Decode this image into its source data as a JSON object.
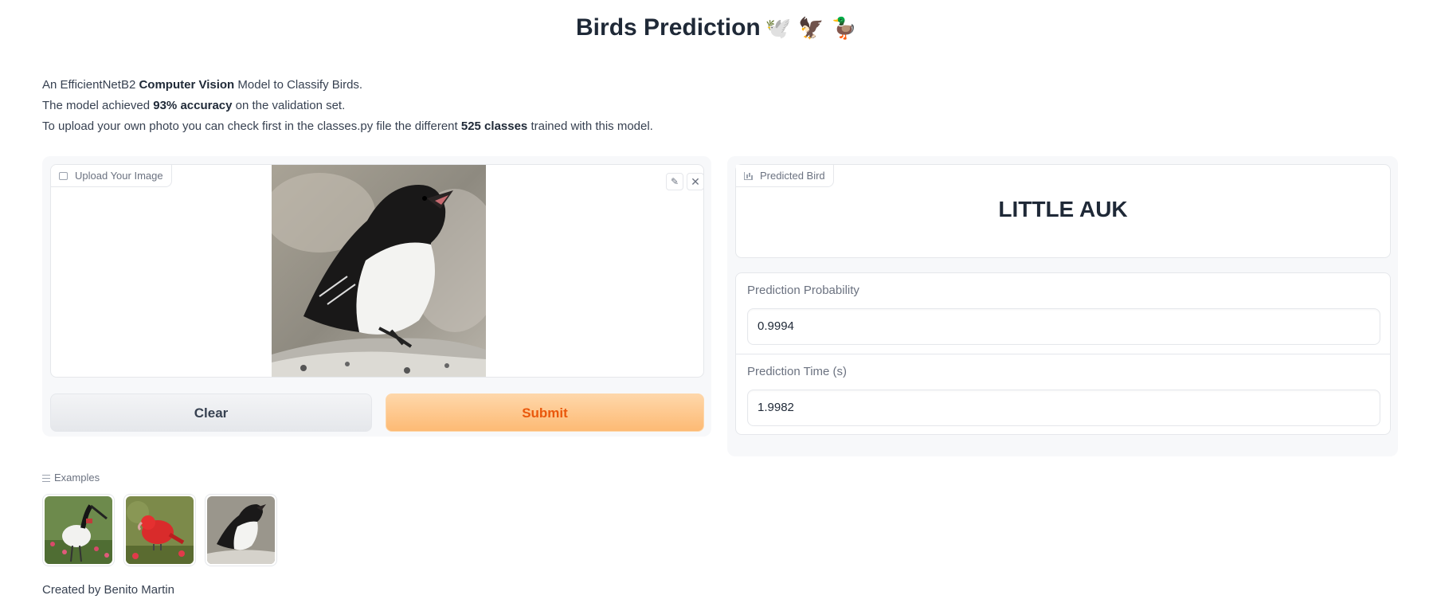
{
  "header": {
    "title": "Birds Prediction",
    "emoji": "🕊️ 🦅 🦆"
  },
  "description": {
    "line1": {
      "pre": "An EfficientNetB2 ",
      "bold": "Computer Vision",
      "post": " Model to Classify Birds."
    },
    "line2": {
      "pre": "The model achieved ",
      "bold": "93% accuracy",
      "post": " on the validation set."
    },
    "line3": {
      "pre": "To upload your own photo you can check first in the classes.py file the different ",
      "bold": "525 classes",
      "post": " trained with this model."
    }
  },
  "upload": {
    "label": "Upload Your Image",
    "edit_icon": "pencil-icon",
    "close_icon": "close-icon"
  },
  "buttons": {
    "clear": "Clear",
    "submit": "Submit"
  },
  "prediction": {
    "label": "Predicted Bird",
    "value": "LITTLE AUK"
  },
  "probability": {
    "label": "Prediction Probability",
    "value": "0.9994"
  },
  "time": {
    "label": "Prediction Time (s)",
    "value": "1.9982"
  },
  "examples": {
    "label": "Examples"
  },
  "footer": {
    "text": "Created by Benito Martin"
  },
  "colors": {
    "accent": "#fdba74",
    "accent_text": "#ea580c",
    "panel_bg": "#f7f8fa"
  }
}
